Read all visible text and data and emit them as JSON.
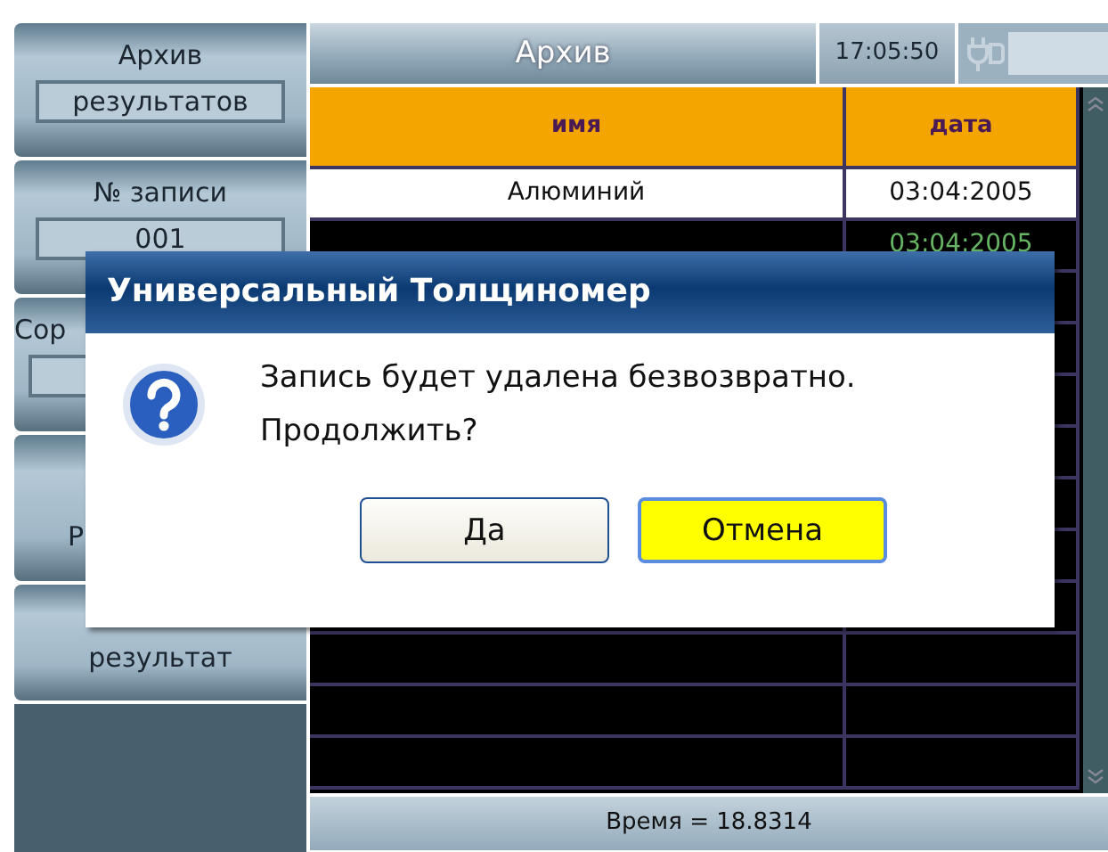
{
  "sidebar": {
    "items": [
      {
        "kind": "field",
        "label": "Архив",
        "value": "результатов"
      },
      {
        "kind": "field",
        "label": "№ записи",
        "value": "001"
      },
      {
        "kind": "covered-field",
        "label": "Сор"
      },
      {
        "kind": "covered",
        "label": "Р"
      },
      {
        "kind": "plain",
        "label": "результат"
      },
      {
        "kind": "empty"
      }
    ]
  },
  "header": {
    "title": "Архив",
    "time": "17:05:50"
  },
  "table": {
    "columns": [
      "имя",
      "дата"
    ],
    "rows": [
      {
        "name": "Алюминий",
        "date": "03:04:2005",
        "selected": true
      },
      {
        "date": "03:04:2005",
        "selected": false
      }
    ]
  },
  "status_bar": "Время = 18.8314",
  "dialog": {
    "title": "Универсальный Толщиномер",
    "message": [
      "Запись будет удалена безвозвратно.",
      "Продолжить?"
    ],
    "buttons": [
      {
        "label": "Да",
        "selected": false
      },
      {
        "label": "Отмена",
        "selected": true
      }
    ]
  }
}
